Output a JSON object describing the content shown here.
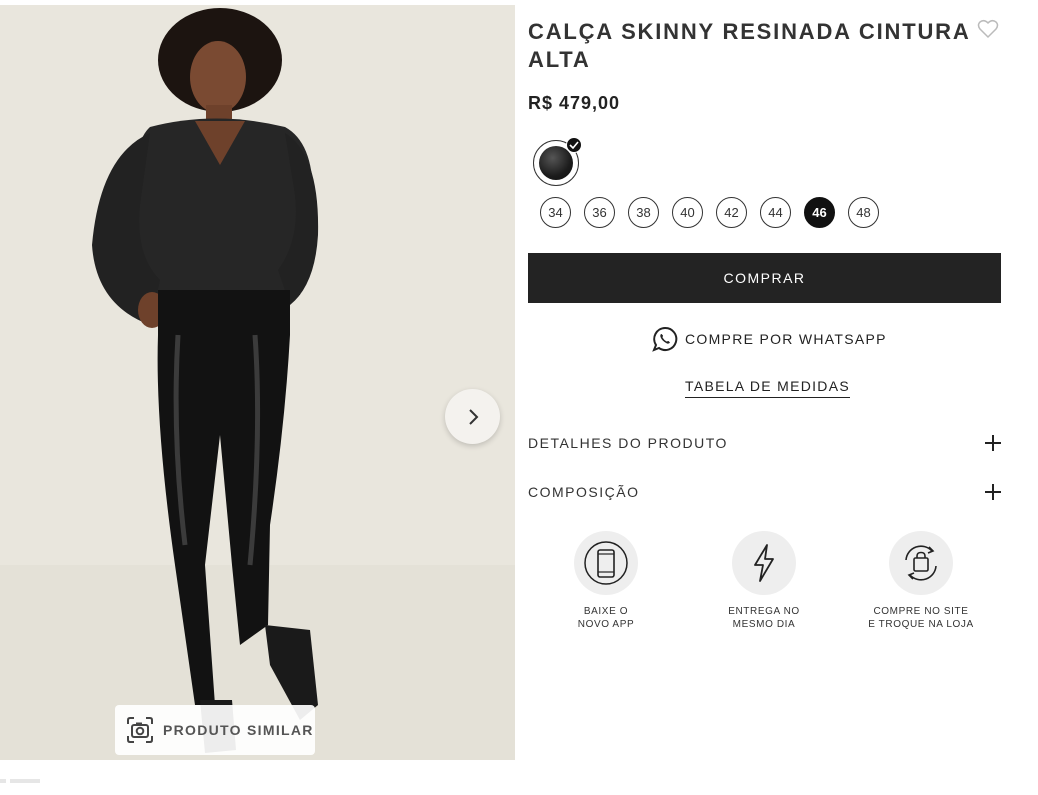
{
  "product": {
    "title": "CALÇA SKINNY RESINADA CINTURA ALTA",
    "price": "R$ 479,00",
    "selected_color": "black"
  },
  "sizes": [
    {
      "label": "34",
      "selected": false
    },
    {
      "label": "36",
      "selected": false
    },
    {
      "label": "38",
      "selected": false
    },
    {
      "label": "40",
      "selected": false
    },
    {
      "label": "42",
      "selected": false
    },
    {
      "label": "44",
      "selected": false
    },
    {
      "label": "46",
      "selected": true
    },
    {
      "label": "48",
      "selected": false
    }
  ],
  "actions": {
    "buy_label": "COMPRAR",
    "whatsapp_label": "COMPRE POR WHATSAPP",
    "size_chart_label": "TABELA DE MEDIDAS"
  },
  "accordion": {
    "details_label": "DETALHES DO PRODUTO",
    "composition_label": "COMPOSIÇÃO"
  },
  "benefits": [
    {
      "line1": "BAIXE O",
      "line2": "NOVO APP",
      "icon": "phone-icon"
    },
    {
      "line1": "ENTREGA NO",
      "line2": "MESMO DIA",
      "icon": "lightning-icon"
    },
    {
      "line1": "COMPRE NO SITE",
      "line2": "E TROQUE NA LOJA",
      "icon": "bag-exchange-icon"
    }
  ],
  "gallery": {
    "similar_label": "PRODUTO SIMILAR",
    "next_icon": "chevron-right-icon",
    "similar_icon": "camera-icon"
  },
  "colors": {
    "button_bg": "#232323",
    "selected_size_bg": "#111111",
    "photo_bg": "#e9e6dd"
  }
}
